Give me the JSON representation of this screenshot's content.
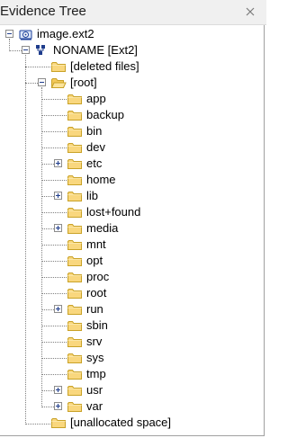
{
  "panel": {
    "title": "Evidence Tree",
    "close_icon": "close-icon"
  },
  "tree": {
    "evidence_label": "image.ext2",
    "volume_label": "NONAME [Ext2]",
    "deleted_label": "[deleted files]",
    "root_label": "[root]",
    "root_children": [
      {
        "label": "app",
        "expandable": false
      },
      {
        "label": "backup",
        "expandable": false
      },
      {
        "label": "bin",
        "expandable": false
      },
      {
        "label": "dev",
        "expandable": false
      },
      {
        "label": "etc",
        "expandable": true
      },
      {
        "label": "home",
        "expandable": false
      },
      {
        "label": "lib",
        "expandable": true
      },
      {
        "label": "lost+found",
        "expandable": false
      },
      {
        "label": "media",
        "expandable": true
      },
      {
        "label": "mnt",
        "expandable": false
      },
      {
        "label": "opt",
        "expandable": false
      },
      {
        "label": "proc",
        "expandable": false
      },
      {
        "label": "root",
        "expandable": false
      },
      {
        "label": "run",
        "expandable": true
      },
      {
        "label": "sbin",
        "expandable": false
      },
      {
        "label": "srv",
        "expandable": false
      },
      {
        "label": "sys",
        "expandable": false
      },
      {
        "label": "tmp",
        "expandable": false
      },
      {
        "label": "usr",
        "expandable": true
      },
      {
        "label": "var",
        "expandable": true
      }
    ],
    "unallocated_label": "[unallocated space]"
  }
}
